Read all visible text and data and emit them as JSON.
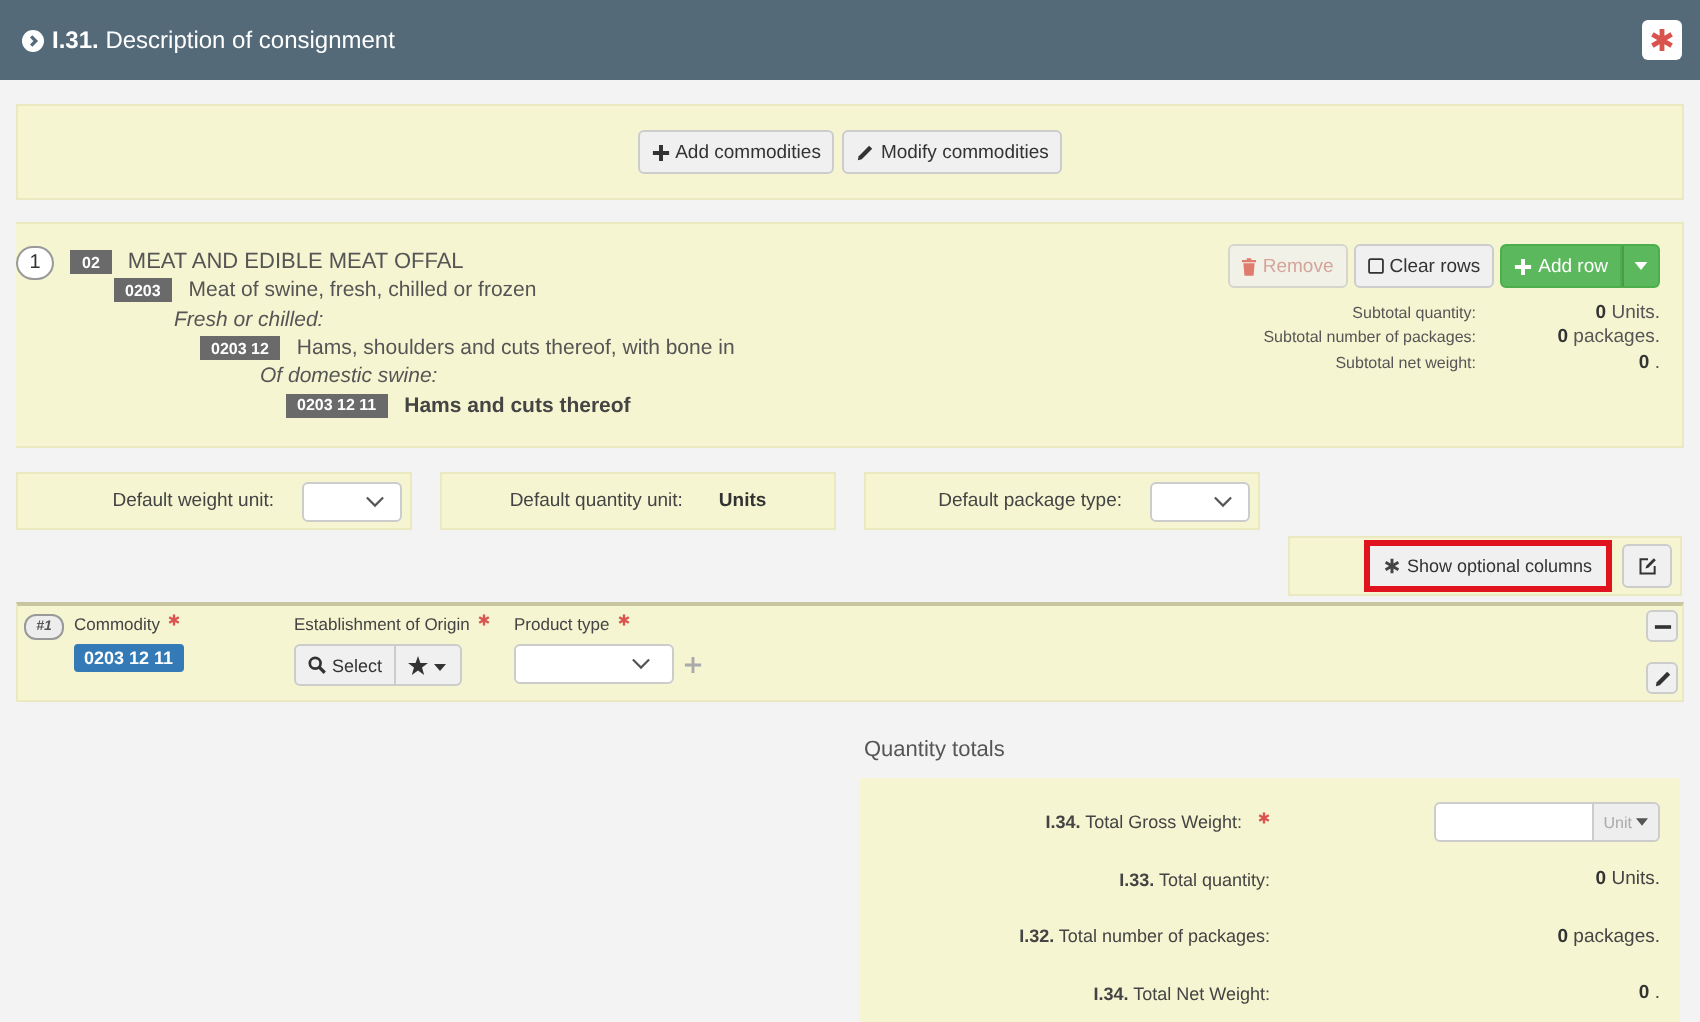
{
  "header": {
    "number": "I.31.",
    "title": "Description of consignment"
  },
  "toolbar": [
    {
      "label": "Add commodities",
      "kind": "add"
    },
    {
      "label": "Modify commodities",
      "kind": "modify"
    }
  ],
  "commodity": {
    "index": "1",
    "tree": [
      {
        "code": "02",
        "label": "MEAT AND EDIBLE MEAT OFFAL",
        "kind": "chapter",
        "children": [
          {
            "code": "0203",
            "label": "Meat of swine, fresh, chilled or frozen",
            "kind": "item",
            "children": [
              {
                "label": "Fresh or chilled:",
                "kind": "group",
                "children": [
                  {
                    "code": "0203 12",
                    "label": "Hams, shoulders and cuts thereof, with bone in",
                    "kind": "item",
                    "children": [
                      {
                        "label": "Of domestic swine:",
                        "kind": "group",
                        "children": [
                          {
                            "code": "0203 12 11",
                            "label": "Hams and cuts thereof",
                            "kind": "selected"
                          }
                        ]
                      }
                    ]
                  }
                ]
              }
            ]
          }
        ]
      }
    ],
    "actions": [
      {
        "label": "Remove",
        "kind": "remove",
        "disabled": true
      },
      {
        "label": "Clear rows",
        "kind": "clear"
      },
      {
        "label": "Add row",
        "kind": "add"
      }
    ],
    "subtotals": [
      {
        "label": "Subtotal quantity:",
        "value": "0",
        "unit": "Units."
      },
      {
        "label": "Subtotal number of packages:",
        "value": "0",
        "unit": "packages."
      },
      {
        "label": "Subtotal net weight:",
        "value": "0",
        "unit": "."
      }
    ]
  },
  "defaults": [
    {
      "label": "Default weight unit:",
      "kind": "select"
    },
    {
      "label": "Default quantity unit:",
      "kind": "text",
      "value": "Units"
    },
    {
      "label": "Default package type:",
      "kind": "select"
    }
  ],
  "optional_columns": {
    "label": "Show optional columns",
    "highlighted": true
  },
  "table": {
    "row_number": "#1",
    "columns": [
      {
        "heading": "Commodity",
        "required": true,
        "kind": "tag",
        "value": "0203 12 11"
      },
      {
        "heading": "Establishment of Origin",
        "required": true,
        "kind": "select_button",
        "value": "Select"
      },
      {
        "heading": "Product type",
        "required": true,
        "kind": "dropdown"
      }
    ]
  },
  "totals": {
    "title": "Quantity totals",
    "rows": [
      {
        "code": "I.34.",
        "label": "Total Gross Weight:",
        "required": true,
        "kind": "input",
        "unit_button": "Unit"
      },
      {
        "code": "I.33.",
        "label": "Total quantity:",
        "required": false,
        "kind": "value",
        "value": "0",
        "unit": "Units."
      },
      {
        "code": "I.32.",
        "label": "Total number of packages:",
        "required": false,
        "kind": "value",
        "value": "0",
        "unit": "packages."
      },
      {
        "code": "I.34.",
        "label": "Total Net Weight:",
        "required": false,
        "kind": "value",
        "value": "0",
        "unit": "."
      }
    ]
  }
}
